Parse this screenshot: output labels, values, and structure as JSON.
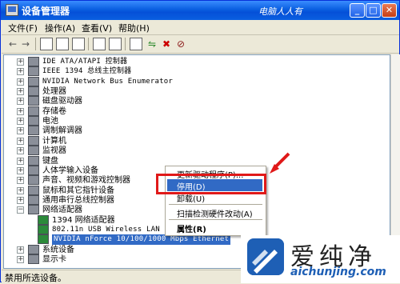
{
  "window": {
    "title": "设备管理器",
    "watermark": "电脑人人有",
    "controls": {
      "minimize": "_",
      "maximize": "□",
      "close": "✕"
    }
  },
  "menu": [
    {
      "label": "文件(F)"
    },
    {
      "label": "操作(A)"
    },
    {
      "label": "查看(V)"
    },
    {
      "label": "帮助(H)"
    }
  ],
  "toolbar": {
    "back": "←",
    "forward": "→"
  },
  "tree": [
    {
      "label": "IDE ATA/ATAPI 控制器",
      "type": "collapsed"
    },
    {
      "label": "IEEE 1394 总线主控制器",
      "type": "collapsed"
    },
    {
      "label": "NVIDIA Network Bus Enumerator",
      "type": "collapsed"
    },
    {
      "label": "处理器",
      "type": "collapsed"
    },
    {
      "label": "磁盘驱动器",
      "type": "collapsed"
    },
    {
      "label": "存储卷",
      "type": "collapsed"
    },
    {
      "label": "电池",
      "type": "collapsed"
    },
    {
      "label": "调制解调器",
      "type": "collapsed"
    },
    {
      "label": "计算机",
      "type": "collapsed"
    },
    {
      "label": "监视器",
      "type": "collapsed"
    },
    {
      "label": "键盘",
      "type": "collapsed"
    },
    {
      "label": "人体学输入设备",
      "type": "collapsed"
    },
    {
      "label": "声音、视频和游戏控制器",
      "type": "collapsed"
    },
    {
      "label": "鼠标和其它指针设备",
      "type": "collapsed"
    },
    {
      "label": "通用串行总线控制器",
      "type": "collapsed"
    },
    {
      "label": "网络适配器",
      "type": "expanded"
    },
    {
      "label": "1394 网络适配器",
      "type": "child"
    },
    {
      "label": "802.11n USB Wireless LAN Card",
      "type": "child"
    },
    {
      "label": "NVIDIA nForce 10/100/1000 Mbps Ethernet",
      "type": "child-selected"
    },
    {
      "label": "系统设备",
      "type": "collapsed"
    },
    {
      "label": "显示卡",
      "type": "collapsed"
    }
  ],
  "context_menu": [
    {
      "label": "更新驱动程序(P)..."
    },
    {
      "label": "停用(D)"
    },
    {
      "label": "卸载(U)"
    },
    {
      "label": "扫描检测硬件改动(A)"
    },
    {
      "label": "属性(R)"
    }
  ],
  "status": "禁用所选设备。",
  "logo": {
    "text": "爱纯净",
    "url": "aichunjing.com"
  },
  "colors": {
    "titlebar": "#0A5FE0",
    "selection": "#316AC5",
    "highlight_box": "#E01919"
  }
}
